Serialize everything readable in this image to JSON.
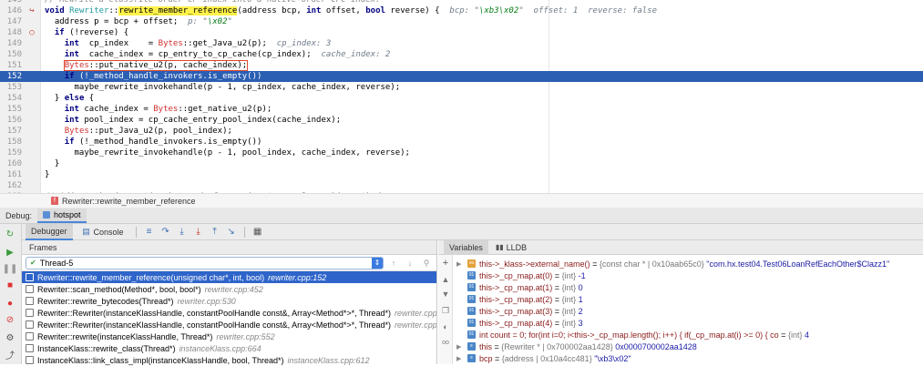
{
  "editor": {
    "lines": [
      {
        "num": "145",
        "gutter": "",
        "html": "<span class='cm'>// Rewrite a classfile-order CP index into a native-order CPC index.</span>"
      },
      {
        "num": "146",
        "gutter": "↪",
        "html": "<span class='kw'>void</span> <span class='ty'>Rewriter</span>::<span class='hl'>rewrite_member_reference</span>(address bcp, <span class='kw'>int</span> offset, <span class='kw'>bool</span> reverse) {  <span class='inl'>bcp: \"<span class='str'>\\xb3\\x02</span>\"  offset: 1  reverse: false</span>"
      },
      {
        "num": "147",
        "gutter": "",
        "html": "  address p = bcp + offset;  <span class='inl'>p: \"<span class='str'>\\x02</span>\"</span>"
      },
      {
        "num": "148",
        "gutter": "○",
        "html": "  <span class='kw'>if</span> (!reverse) {"
      },
      {
        "num": "149",
        "gutter": "",
        "html": "    <span class='kw'>int</span>  cp_index    = <span class='red-cls'>Bytes</span>::get_Java_u2(p);  <span class='inl'>cp_index: 3</span>"
      },
      {
        "num": "150",
        "gutter": "",
        "html": "    <span class='kw'>int</span>  cache_index = cp_entry_to_cp_cache(cp_index);  <span class='inl'>cache_index: 2</span>"
      },
      {
        "num": "151",
        "gutter": "",
        "html": "    <span class='box'><span class='red-cls'>Bytes</span>::put_native_u2(p, cache_index);</span>"
      },
      {
        "num": "152",
        "gutter": "",
        "html": "    <span class='kw'>if</span> (!_method_handle_invokers.is_empty())",
        "cls": "current"
      },
      {
        "num": "153",
        "gutter": "",
        "html": "      maybe_rewrite_invokehandle(p - 1, cp_index, cache_index, reverse);"
      },
      {
        "num": "154",
        "gutter": "",
        "html": "  } <span class='kw'>else</span> {"
      },
      {
        "num": "155",
        "gutter": "",
        "html": "    <span class='kw'>int</span> cache_index = <span class='red-cls'>Bytes</span>::get_native_u2(p);"
      },
      {
        "num": "156",
        "gutter": "",
        "html": "    <span class='kw'>int</span> pool_index = cp_cache_entry_pool_index(cache_index);"
      },
      {
        "num": "157",
        "gutter": "",
        "html": "    <span class='red-cls'>Bytes</span>::put_Java_u2(p, pool_index);"
      },
      {
        "num": "158",
        "gutter": "",
        "html": "    <span class='kw'>if</span> (!_method_handle_invokers.is_empty())"
      },
      {
        "num": "159",
        "gutter": "",
        "html": "      maybe_rewrite_invokehandle(p - 1, pool_index, cache_index, reverse);"
      },
      {
        "num": "160",
        "gutter": "",
        "html": "  }"
      },
      {
        "num": "161",
        "gutter": "",
        "html": "}"
      },
      {
        "num": "162",
        "gutter": "",
        "html": ""
      },
      {
        "num": "163",
        "gutter": "",
        "html": "<span class='cm'>// Adjust the invocation bytecode for a signature-polymorphic method.</span>"
      }
    ]
  },
  "breadcrumb": {
    "badge": "f",
    "text": "Rewriter::rewrite_member_reference"
  },
  "debug": {
    "label": "Debug:",
    "session": "hotspot",
    "tabs": {
      "debugger": "Debugger",
      "console": "Console"
    },
    "frames_title": "Frames",
    "thread": "Thread-5",
    "frames": [
      {
        "name": "Rewriter::rewrite_member_reference(unsigned char*, int, bool)",
        "loc": "rewriter.cpp:152",
        "sel": true
      },
      {
        "name": "Rewriter::scan_method(Method*, bool, bool*)",
        "loc": "rewriter.cpp:452"
      },
      {
        "name": "Rewriter::rewrite_bytecodes(Thread*)",
        "loc": "rewriter.cpp:530"
      },
      {
        "name": "Rewriter::Rewriter(instanceKlassHandle, constantPoolHandle const&, Array<Method*>*, Thread*)",
        "loc": "rewriter.cpp:..."
      },
      {
        "name": "Rewriter::Rewriter(instanceKlassHandle, constantPoolHandle const&, Array<Method*>*, Thread*)",
        "loc": "rewriter.cpp:..."
      },
      {
        "name": "Rewriter::rewrite(instanceKlassHandle, Thread*)",
        "loc": "rewriter.cpp:552"
      },
      {
        "name": "InstanceKlass::rewrite_class(Thread*)",
        "loc": "instanceKlass.cpp:664"
      },
      {
        "name": "InstanceKlass::link_class_impl(instanceKlassHandle, bool, Thread*)",
        "loc": "instanceKlass.cpp:612"
      }
    ],
    "vars_tabs": {
      "variables": "Variables",
      "lldb": "LLDB"
    },
    "variables": [
      {
        "exp": "▶",
        "badge": "oo",
        "orange": true,
        "name": "this->_klass->external_name()",
        "eq": " = ",
        "type": "{const char * | 0x10aab65c0}",
        "val": " \"com.hx.test04.Test06LoanRefEachOther$Clazz1\""
      },
      {
        "exp": "",
        "badge": "01",
        "name": "this->_cp_map.at(0)",
        "eq": " = ",
        "type": "{int}",
        "val": " -1"
      },
      {
        "exp": "",
        "badge": "01",
        "name": "this->_cp_map.at(1)",
        "eq": " = ",
        "type": "{int}",
        "val": " 0"
      },
      {
        "exp": "",
        "badge": "01",
        "name": "this->_cp_map.at(2)",
        "eq": " = ",
        "type": "{int}",
        "val": " 1"
      },
      {
        "exp": "",
        "badge": "01",
        "name": "this->_cp_map.at(3)",
        "eq": " = ",
        "type": "{int}",
        "val": " 2"
      },
      {
        "exp": "",
        "badge": "01",
        "name": "this->_cp_map.at(4)",
        "eq": " = ",
        "type": "{int}",
        "val": " 3"
      },
      {
        "exp": "",
        "badge": "01",
        "name": "int count = 0; for(int i=0; i<this->_cp_map.length(); i++) {     if(_cp_map.at(i) >= 0) {         co",
        "eq": " = ",
        "type": "{int}",
        "val": " 4"
      },
      {
        "exp": "▶",
        "badge": "≡",
        "name": "this",
        "eq": " = ",
        "type": "{Rewriter * | 0x700002aa1428}",
        "val": " 0x0000700002aa1428"
      },
      {
        "exp": "▶",
        "badge": "≡",
        "name": "bcp",
        "eq": " = ",
        "type": "{address | 0x10a4cc481}",
        "val": " \"\\xb3\\x02\""
      }
    ]
  }
}
